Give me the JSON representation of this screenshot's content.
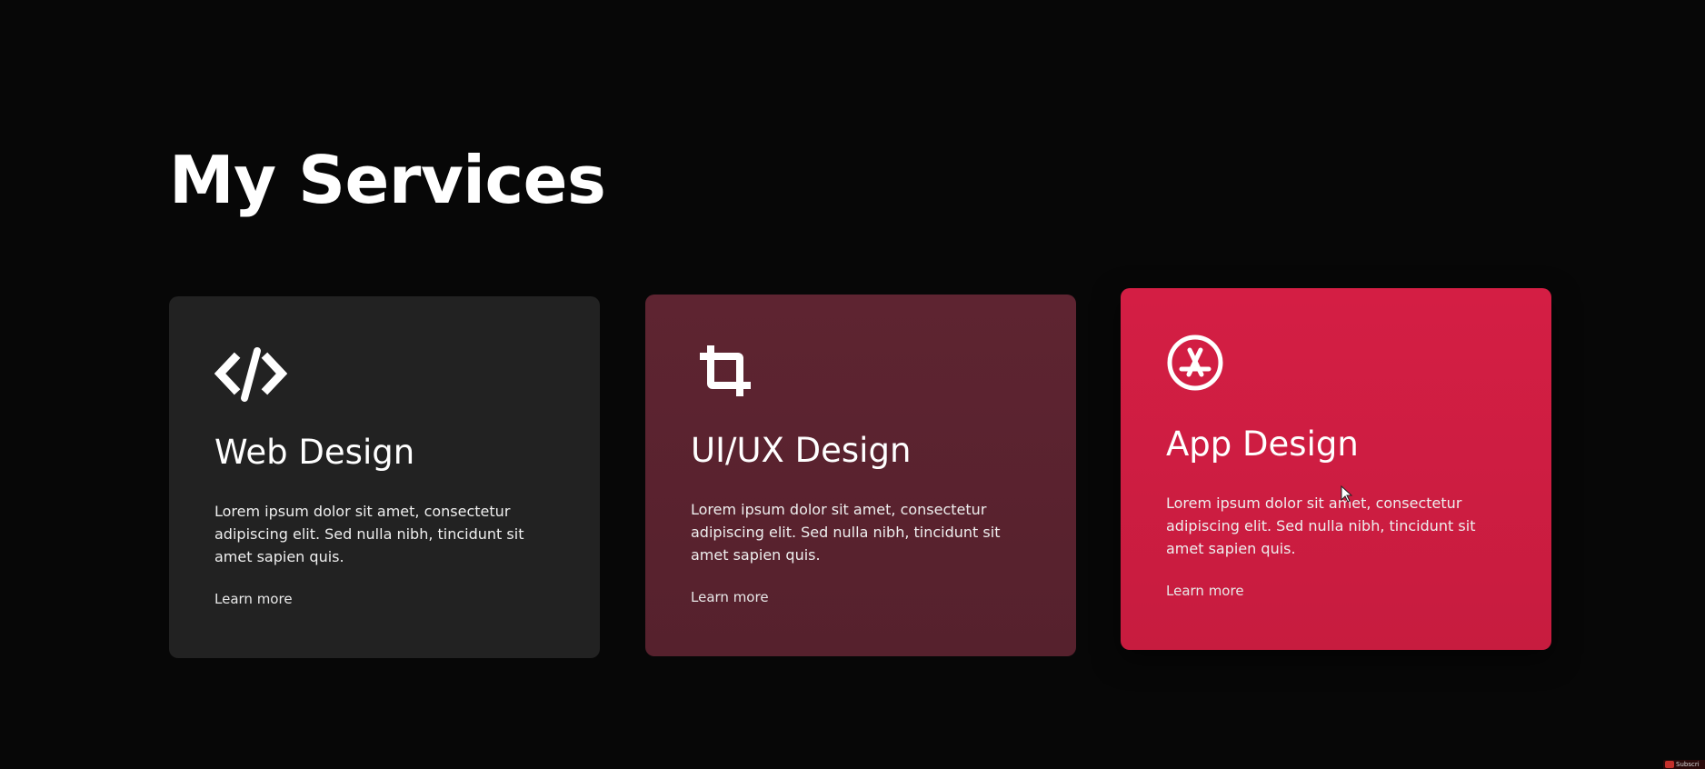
{
  "section": {
    "title": "My Services"
  },
  "cards": [
    {
      "icon": "code-icon",
      "title": "Web Design",
      "description": "Lorem ipsum dolor sit amet, consectetur adipiscing elit. Sed nulla nibh, tincidunt sit amet sapien quis.",
      "link": "Learn more",
      "background": "#222222"
    },
    {
      "icon": "crop-icon",
      "title": "UI/UX Design",
      "description": "Lorem ipsum dolor sit amet, consectetur adipiscing elit. Sed nulla nibh, tincidunt sit amet sapien quis.",
      "link": "Learn more",
      "background": "#5e2431"
    },
    {
      "icon": "app-store-icon",
      "title": "App Design",
      "description": "Lorem ipsum dolor sit amet, consectetur adipiscing elit. Sed nulla nibh, tincidunt sit amet sapien quis.",
      "link": "Learn more",
      "background": "#d41e44"
    }
  ],
  "colors": {
    "page_background": "#070707",
    "text": "#ffffff",
    "accent": "#d41e44"
  },
  "overlay": {
    "badge_text": "Subscri"
  }
}
